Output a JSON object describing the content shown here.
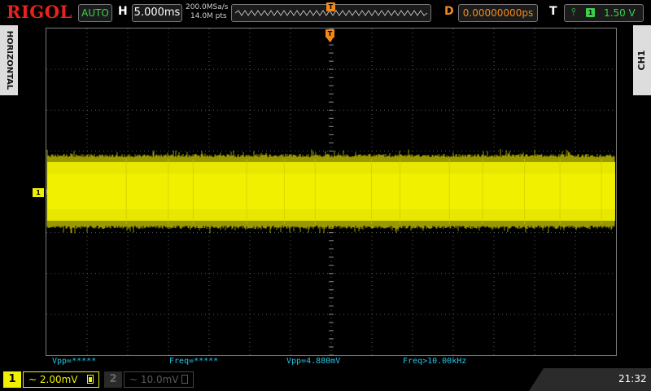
{
  "brand": {
    "logo": "RIGOL"
  },
  "acquisition": {
    "trigger_mode": "AUTO",
    "horizontal_label": "H",
    "timebase": "5.000ms",
    "sample_rate": "200.0MSa/s",
    "memory_depth": "14.0M pts"
  },
  "trigger": {
    "delay_label": "D",
    "delay": "0.00000000ps",
    "trigger_label": "T",
    "edge_icon": "rising-edge-icon",
    "source": "1",
    "level": "1.50 V",
    "position_marker": "T"
  },
  "side_tabs": {
    "left": "HORIZONTAL",
    "right": "CH1"
  },
  "channel1": {
    "offset_marker": "1",
    "color": "#f0f000"
  },
  "measurements": [
    {
      "text": "Vpp=*****"
    },
    {
      "text": "Freq=*****"
    },
    {
      "text": "Vpp=4.880mV"
    },
    {
      "text": "Freq>10.00kHz"
    }
  ],
  "channels": [
    {
      "number": "1",
      "scale": "~ 2.00mV",
      "active": true
    },
    {
      "number": "2",
      "scale": "~ 10.0mV",
      "active": false
    }
  ],
  "clock": "21:32",
  "colors": {
    "ch1": "#f0f000",
    "trigger": "#f28a1b",
    "measurement": "#26c6e6",
    "brand": "#e8231f",
    "mode": "#39d34a"
  }
}
